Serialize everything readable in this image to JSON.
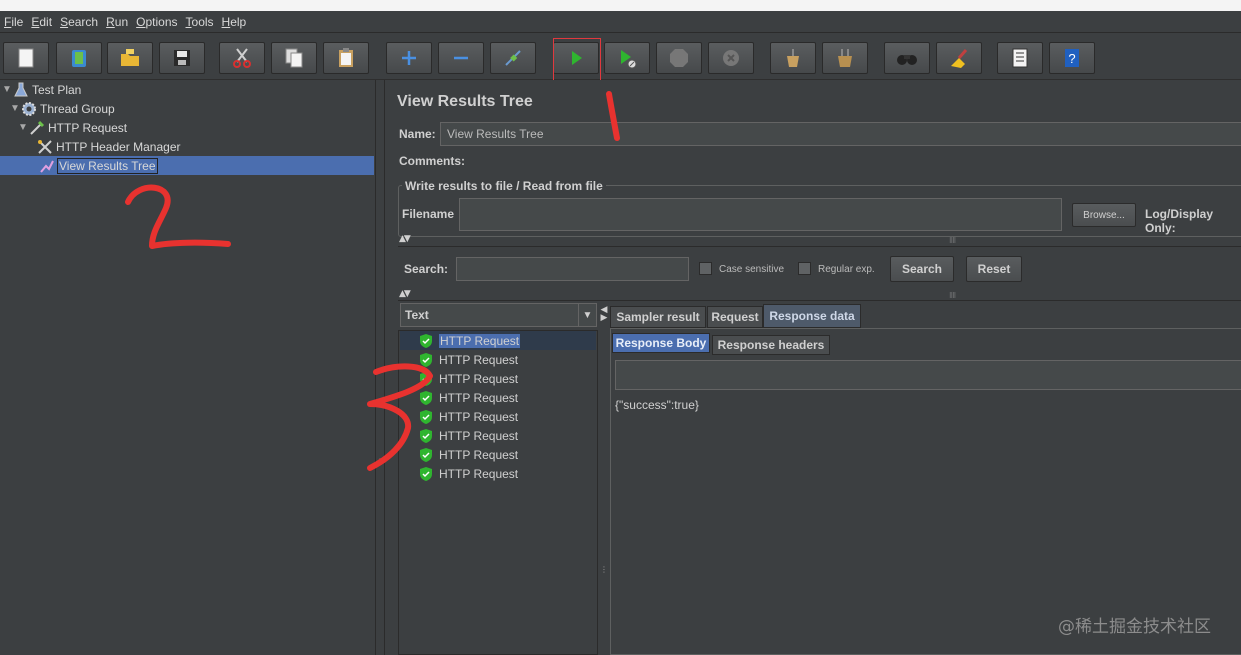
{
  "menu": [
    "File",
    "Edit",
    "Search",
    "Run",
    "Options",
    "Tools",
    "Help"
  ],
  "toolbar": {
    "buttons": [
      "new-icon",
      "templates-icon",
      "open-icon",
      "save-icon",
      "cut-icon",
      "copy-icon",
      "paste-icon",
      "expand-icon",
      "collapse-icon",
      "toggle-icon",
      "start-icon",
      "start-no-timers-icon",
      "stop-icon",
      "shutdown-icon",
      "clear-icon",
      "clear-all-icon",
      "search-binoculars-icon",
      "reset-search-icon",
      "function-helper-icon",
      "help-icon"
    ]
  },
  "tree": {
    "items": [
      {
        "label": "Test Plan",
        "icon": "test-plan-icon"
      },
      {
        "label": "Thread Group",
        "icon": "gear-icon"
      },
      {
        "label": "HTTP Request",
        "icon": "pipette-icon"
      },
      {
        "label": "HTTP Header Manager",
        "icon": "tools-icon"
      },
      {
        "label": "View Results Tree",
        "icon": "chart-icon",
        "selected": true
      }
    ]
  },
  "panel": {
    "title": "View Results Tree",
    "name_label": "Name:",
    "name_value": "View Results Tree",
    "comments_label": "Comments:",
    "file_group_label": "Write results to file / Read from file",
    "filename_label": "Filename",
    "browse_label": "Browse...",
    "log_display_label": "Log/Display Only:"
  },
  "search": {
    "label": "Search:",
    "case_sensitive": "Case sensitive",
    "regular_exp": "Regular exp.",
    "search_button": "Search",
    "reset_button": "Reset"
  },
  "results": {
    "renderer": "Text",
    "items": [
      "HTTP Request",
      "HTTP Request",
      "HTTP Request",
      "HTTP Request",
      "HTTP Request",
      "HTTP Request",
      "HTTP Request",
      "HTTP Request"
    ],
    "tabs": [
      "Sampler result",
      "Request",
      "Response data"
    ],
    "active_tab": "Response data",
    "subtabs": [
      "Response Body",
      "Response headers"
    ],
    "body": "{\"success\":true}"
  },
  "annotations": [
    "1",
    "2",
    "3"
  ],
  "watermark": "@稀土掘金技术社区",
  "colors": {
    "selection": "#4b6eaf",
    "annotation": "#e8322f",
    "background": "#3c3f41"
  }
}
